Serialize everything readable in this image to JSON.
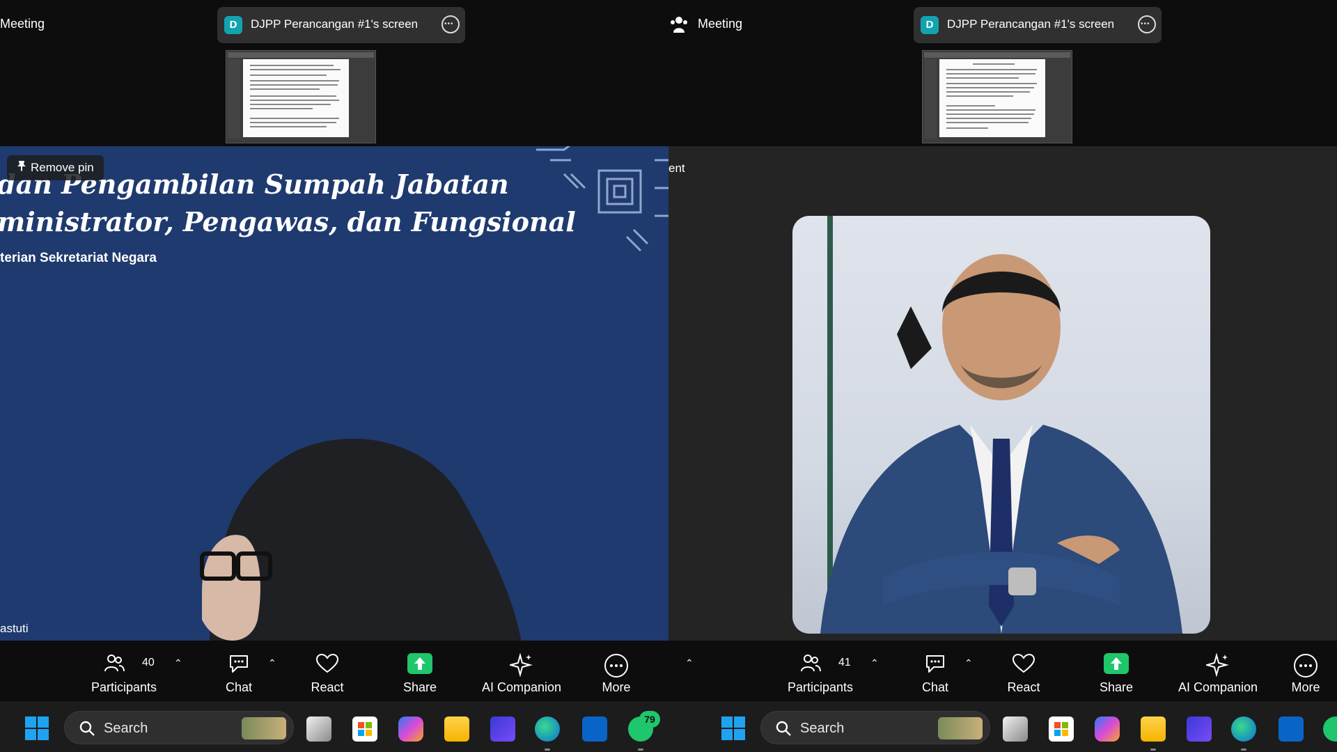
{
  "left": {
    "topbar": {
      "meeting_label": "Meeting",
      "screen_share_avatar": "D",
      "screen_share_label": "DJPP Perancangan #1's screen"
    },
    "slide": {
      "title_line1": "dan Pengambilan Sumpah Jabatan",
      "title_line2": "ministrator, Pengawas, dan Fungsional",
      "subtitle": "terian Sekretariat Negara"
    },
    "pin_label": "Remove pin",
    "participant_name": "astuti",
    "toolbar": {
      "participants_label": "Participants",
      "participants_count": "40",
      "chat_label": "Chat",
      "react_label": "React",
      "share_label": "Share",
      "ai_label": "AI Companion",
      "more_label": "More"
    }
  },
  "right": {
    "topbar": {
      "meeting_label": "Meeting",
      "screen_share_avatar": "D",
      "screen_share_label": "DJPP Perancangan #1's screen"
    },
    "partial_label": "ent",
    "toolbar": {
      "participants_label": "Participants",
      "participants_count": "41",
      "chat_label": "Chat",
      "react_label": "React",
      "share_label": "Share",
      "ai_label": "AI Companion",
      "more_label": "More"
    }
  },
  "taskbar": {
    "search_label": "Search",
    "whatsapp_badge": "79",
    "apps_left": [
      "task-view-icon",
      "store-icon",
      "copilot-icon",
      "file-explorer-icon",
      "app-icon",
      "edge-icon",
      "outlook-icon",
      "whatsapp-icon"
    ],
    "apps_right": [
      "task-view-icon",
      "store-icon",
      "copilot-icon",
      "file-explorer-icon",
      "app-icon",
      "edge-icon",
      "outlook-icon",
      "whatsapp-icon"
    ]
  },
  "colors": {
    "share_green": "#1fc66c",
    "slide_blue": "#1f3a6e",
    "avatar_teal": "#13a3b0"
  }
}
